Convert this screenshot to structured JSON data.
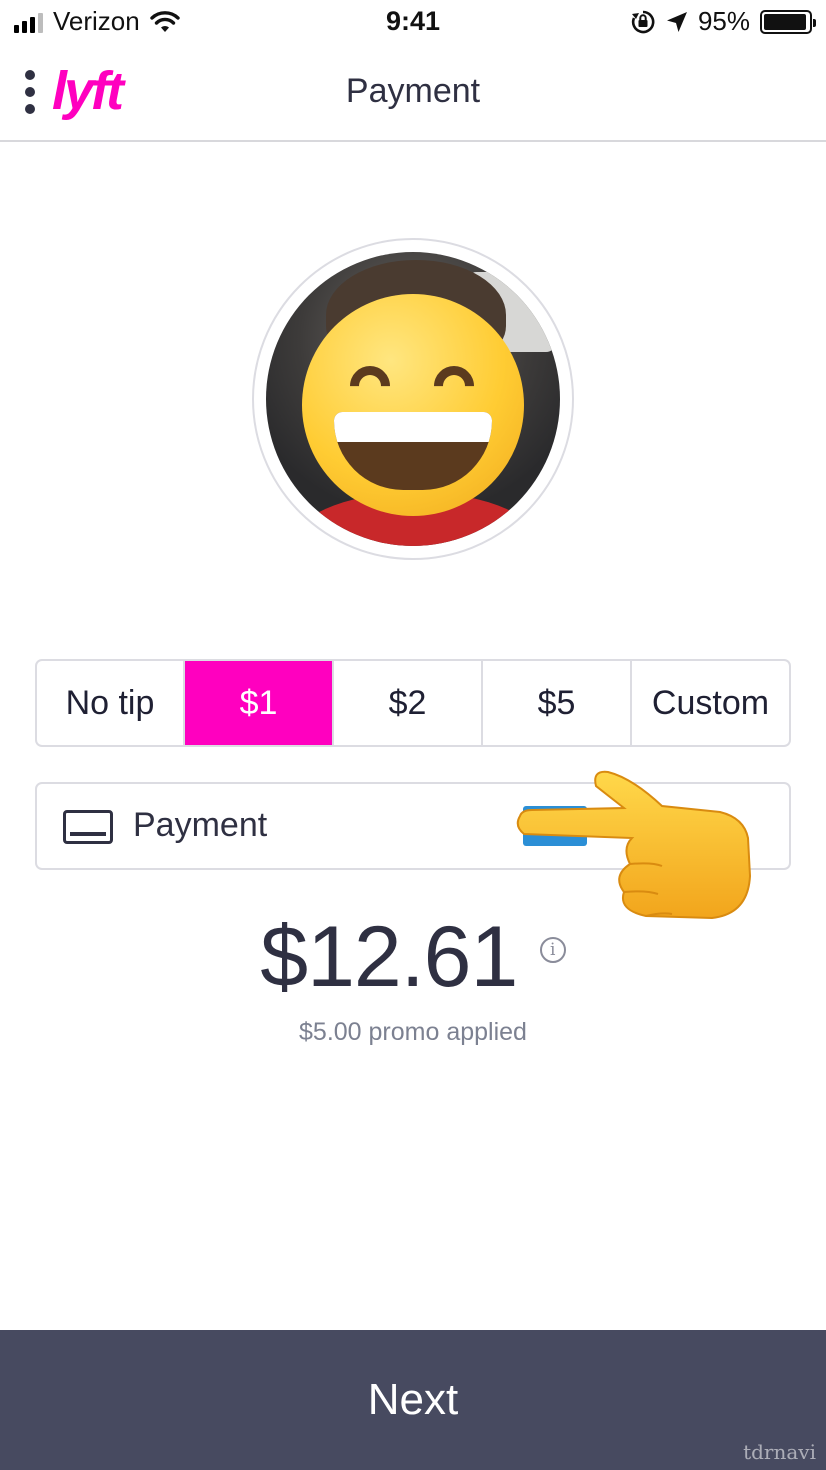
{
  "status_bar": {
    "carrier": "Verizon",
    "time": "9:41",
    "battery_percent": "95%",
    "battery_level": 0.95,
    "signal_bars": 3,
    "icons": [
      "signal-icon",
      "wifi-icon",
      "orientation-lock-icon",
      "location-arrow-icon",
      "battery-icon"
    ]
  },
  "nav": {
    "logo": "lyft",
    "title": "Payment",
    "menu_icon": "vertical-dots-icon"
  },
  "driver": {
    "avatar": "driver-photo-with-smiling-emoji"
  },
  "tips": {
    "options": [
      "No tip",
      "$1",
      "$2",
      "$5",
      "Custom"
    ],
    "selected": "$1"
  },
  "payment": {
    "label": "Payment",
    "icon": "credit-card-icon"
  },
  "fare": {
    "amount": "$12.61",
    "info_glyph": "i",
    "promo": "$5.00 promo applied"
  },
  "footer": {
    "next_label": "Next"
  },
  "watermark": "tdrnavi",
  "colors": {
    "brand_pink": "#ff00bf",
    "text_dark": "#2f3042",
    "next_bg": "#474a60"
  }
}
